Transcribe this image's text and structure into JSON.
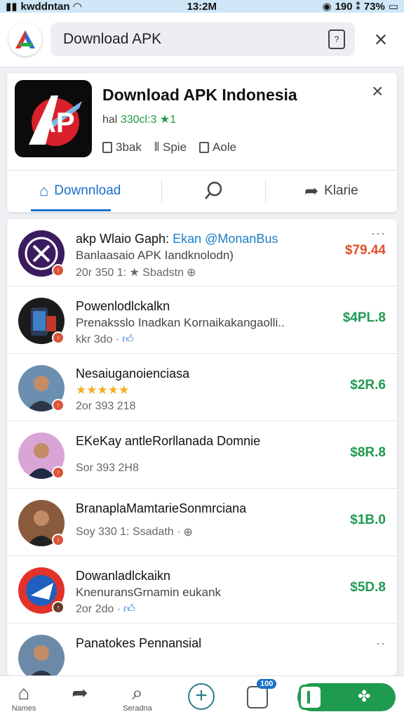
{
  "status_bar": {
    "carrier": "kwddntan",
    "time": "13:2M",
    "battery_info": "190 ⁑ 73%"
  },
  "header": {
    "search_value": "Download APK",
    "clipboard_glyph": "?"
  },
  "featured": {
    "title": "Download APK Indonesia",
    "subtitle_prefix": "hal",
    "subtitle_green": "330cl:3 ★1",
    "meta": [
      "3bak",
      "Spie",
      "Aole"
    ],
    "actions": {
      "download": "Downnload",
      "share": "Klarie"
    }
  },
  "list": [
    {
      "title": "akp Wlaio Gaph:",
      "handle": "Ekan @MonanBus",
      "desc": "Banlaasaio APK Iandknolodn)",
      "meta": "20r 350 1: ★ Sbadstn",
      "price": "$79.44",
      "price_color": "red"
    },
    {
      "title": "Powenlodlckalkn",
      "desc": "Prenaksslo Inadkan Kornaikakangaolli..",
      "meta": "kkr 3do ·",
      "price": "$4PL.8"
    },
    {
      "title": "Nesaiuganoienciasa",
      "desc": "★★★★★",
      "meta": "2or 393 218",
      "price": "$2R.6"
    },
    {
      "title": "EKeKay antleRorllanada Domnie",
      "desc": "",
      "meta": "Sor 393 2H8",
      "price": "$8R.8"
    },
    {
      "title": "BranaplaMamtarieSonmrciana",
      "desc": "",
      "meta": "Soy 330 1: Ssadath ·",
      "price": "$1B.0"
    },
    {
      "title": "Dowanladlckaikn",
      "desc": "KnenuransGrnamin eukank",
      "meta": "2or 2do ·",
      "price": "$5D.8"
    },
    {
      "title": "Panatokes Pennansial",
      "desc": "",
      "meta": "",
      "price": ""
    }
  ],
  "bottom_nav": {
    "home": "Names",
    "search": "Seradna",
    "badge_count": "100"
  },
  "colors": {
    "accent_blue": "#1a6fc9",
    "price_green": "#1e9b4f",
    "price_red": "#e0502a"
  }
}
